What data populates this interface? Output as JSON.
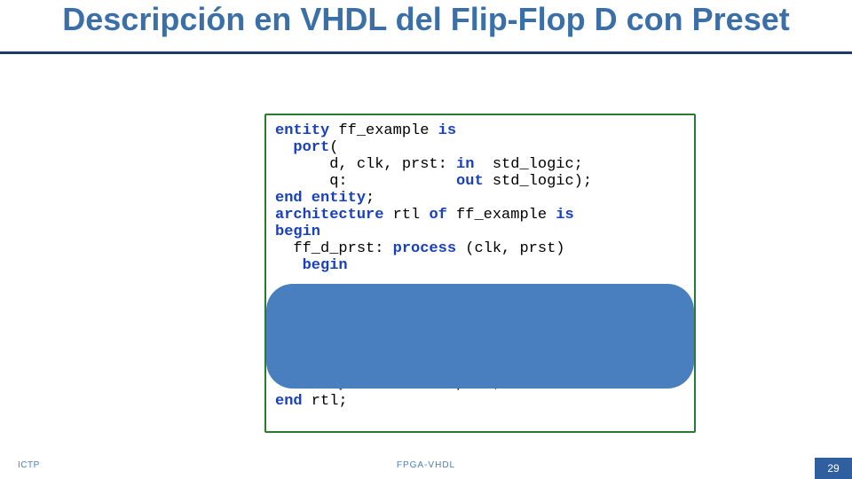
{
  "title": "Descripción en VHDL del Flip-Flop D con Preset",
  "code": {
    "tokens": [
      {
        "t": "entity",
        "c": "kw"
      },
      {
        "t": " ff_example ",
        "c": "norm"
      },
      {
        "t": "is",
        "c": "kw"
      },
      {
        "t": "\n",
        "c": "norm"
      },
      {
        "t": "  ",
        "c": "norm"
      },
      {
        "t": "port",
        "c": "kw"
      },
      {
        "t": "(",
        "c": "norm"
      },
      {
        "t": "\n",
        "c": "norm"
      },
      {
        "t": "      d, clk, prst: ",
        "c": "norm"
      },
      {
        "t": "in",
        "c": "kw"
      },
      {
        "t": "  std_logic;",
        "c": "norm"
      },
      {
        "t": "\n",
        "c": "norm"
      },
      {
        "t": "      q:            ",
        "c": "norm"
      },
      {
        "t": "out",
        "c": "kw"
      },
      {
        "t": " std_logic);",
        "c": "norm"
      },
      {
        "t": "\n",
        "c": "norm"
      },
      {
        "t": "end entity",
        "c": "kw"
      },
      {
        "t": ";",
        "c": "norm"
      },
      {
        "t": "\n",
        "c": "norm"
      },
      {
        "t": "architecture",
        "c": "kw"
      },
      {
        "t": " rtl ",
        "c": "norm"
      },
      {
        "t": "of",
        "c": "kw"
      },
      {
        "t": " ff_example ",
        "c": "norm"
      },
      {
        "t": "is",
        "c": "kw"
      },
      {
        "t": "\n",
        "c": "norm"
      },
      {
        "t": "begin",
        "c": "kw"
      },
      {
        "t": "\n",
        "c": "norm"
      },
      {
        "t": "  ff_d_prst: ",
        "c": "norm"
      },
      {
        "t": "process",
        "c": "kw"
      },
      {
        "t": " (clk, prst)",
        "c": "norm"
      },
      {
        "t": "\n",
        "c": "norm"
      },
      {
        "t": "   ",
        "c": "norm"
      },
      {
        "t": "begin",
        "c": "kw"
      },
      {
        "t": "\n",
        "c": "norm"
      },
      {
        "t": "\n",
        "c": "norm"
      },
      {
        "t": "\n",
        "c": "norm"
      },
      {
        "t": "\n",
        "c": "norm"
      },
      {
        "t": "\n",
        "c": "norm"
      },
      {
        "t": "\n",
        "c": "norm"
      },
      {
        "t": "\n",
        "c": "norm"
      },
      {
        "t": "   ",
        "c": "norm"
      },
      {
        "t": "end process",
        "c": "kw"
      },
      {
        "t": " ff_d_prst;",
        "c": "norm"
      },
      {
        "t": "\n",
        "c": "norm"
      },
      {
        "t": "end",
        "c": "kw"
      },
      {
        "t": " rtl;",
        "c": "norm"
      }
    ]
  },
  "footer": {
    "left": "ICTP",
    "center": "FPGA-VHDL",
    "page": "29"
  }
}
